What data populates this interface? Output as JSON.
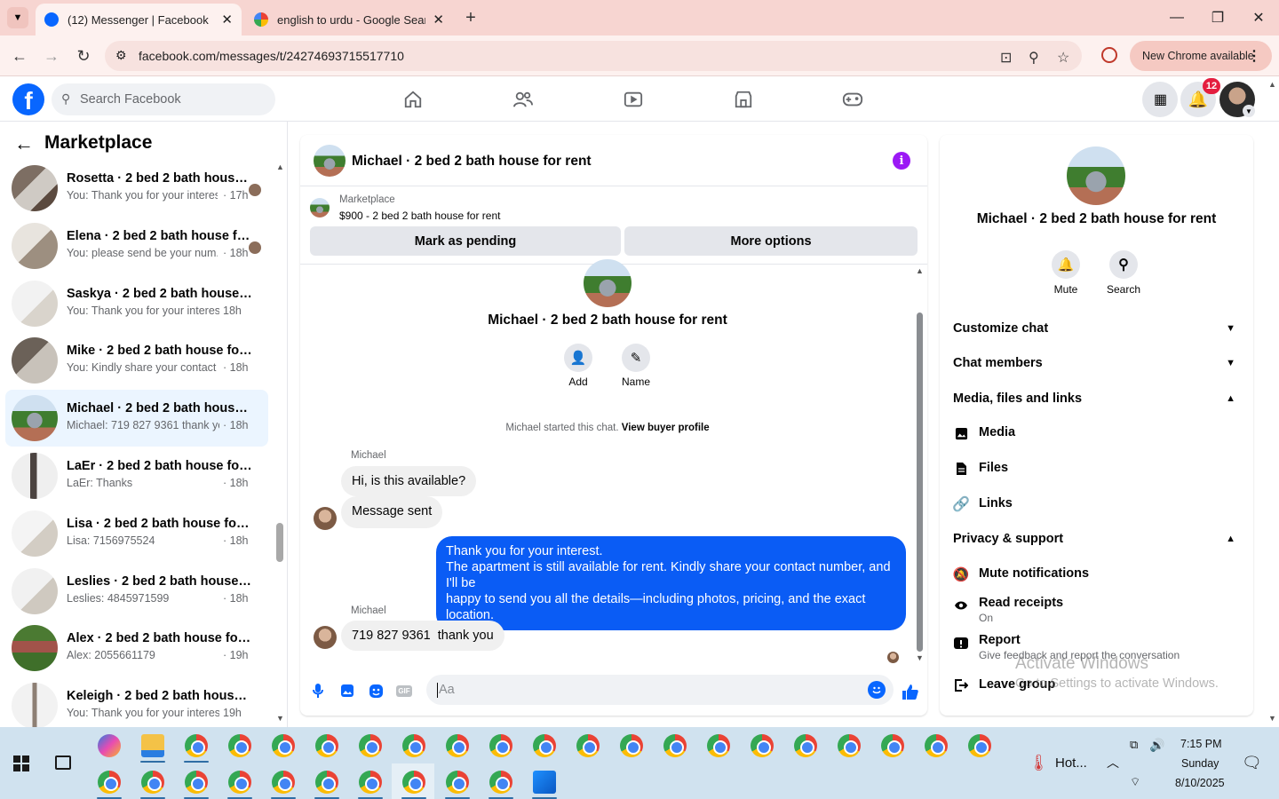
{
  "browser": {
    "tabs": [
      {
        "title": "(12) Messenger | Facebook",
        "active": true
      },
      {
        "title": "english to urdu - Google Search",
        "active": false
      }
    ],
    "url": "facebook.com/messages/t/24274693715517710",
    "new_chrome_label": "New Chrome available"
  },
  "facebook": {
    "search_placeholder": "Search Facebook",
    "notification_count": "12"
  },
  "left": {
    "title": "Marketplace",
    "chats": [
      {
        "name": "Rosetta · 2 bed 2 bath house for rent",
        "preview": "You: Thank you for your interes...",
        "time": "· 17h",
        "seen": true,
        "selected": false
      },
      {
        "name": "Elena · 2 bed 2 bath house for rent",
        "preview": "You: please send be your num...",
        "time": "· 18h",
        "seen": true,
        "selected": false
      },
      {
        "name": "Saskya · 2 bed 2 bath house for rent",
        "preview": "You: Thank you for your interest. T...",
        "time": "18h",
        "seen": false,
        "selected": false
      },
      {
        "name": "Mike · 2 bed 2 bath house for rent",
        "preview": "You: Kindly share your contact nu...",
        "time": "· 18h",
        "seen": false,
        "selected": false
      },
      {
        "name": "Michael · 2 bed 2 bath house for rent",
        "preview": "Michael: 719 827 9361 thank you",
        "time": "· 18h",
        "seen": false,
        "selected": true
      },
      {
        "name": "LaEr · 2 bed 2 bath house for rent",
        "preview": "LaEr: Thanks",
        "time": "· 18h",
        "seen": false,
        "selected": false
      },
      {
        "name": "Lisa · 2 bed 2 bath house for rent",
        "preview": "Lisa: 7156975524",
        "time": "· 18h",
        "seen": false,
        "selected": false
      },
      {
        "name": "Leslies · 2 bed 2 bath house for rent",
        "preview": "Leslies: 4845971599",
        "time": "· 18h",
        "seen": false,
        "selected": false
      },
      {
        "name": "Alex · 2 bed 2 bath house for rent",
        "preview": "Alex: 2055661179",
        "time": "· 19h",
        "seen": false,
        "selected": false
      },
      {
        "name": "Keleigh · 2 bed 2 bath house for rent",
        "preview": "You: Thank you for your interest. T...",
        "time": "19h",
        "seen": false,
        "selected": false
      }
    ]
  },
  "conversation": {
    "title": "Michael · 2 bed 2 bath house for rent",
    "listing_label": "Marketplace",
    "listing_price": "$900 - 2 bed 2 bath house for rent",
    "mark_pending": "Mark as pending",
    "more_options": "More options",
    "profile_title": "Michael · 2 bed 2 bath house for rent",
    "add_label": "Add",
    "name_label": "Name",
    "started_text": "Michael started this chat.",
    "view_profile": "View buyer profile",
    "sender_name": "Michael",
    "msg1": "Hi, is this available?",
    "msg2": "Message sent",
    "msg3_line1": "Thank you for your interest.",
    "msg3_line2": "The apartment is still available for rent. Kindly share your contact number, and I'll be",
    "msg3_line3": "happy to send you all the details—including photos, pricing, and the exact location.",
    "msg4": "719 827 9361  thank you",
    "composer_placeholder": "Aa"
  },
  "info": {
    "title": "Michael · 2 bed 2 bath house for rent",
    "mute": "Mute",
    "search": "Search",
    "sections": {
      "customize": "Customize chat",
      "members": "Chat members",
      "media_files": "Media, files and links",
      "privacy": "Privacy & support"
    },
    "media": "Media",
    "files": "Files",
    "links": "Links",
    "mute_notifications": "Mute notifications",
    "read_receipts": "Read receipts",
    "read_receipts_state": "On",
    "report": "Report",
    "report_sub": "Give feedback and report the conversation",
    "leave_group": "Leave group",
    "watermark_title": "Activate Windows",
    "watermark_sub": "Go to Settings to activate Windows."
  },
  "taskbar": {
    "weather": "Hot...",
    "time": "7:15 PM",
    "day": "Sunday",
    "date": "8/10/2025"
  },
  "colors": {
    "fb_blue": "#0866ff",
    "outgoing_bubble": "#0a5cf5",
    "selected_row": "#ebf5ff",
    "tab_strip": "#f7d5d1",
    "badge_red": "#e41e3f"
  }
}
